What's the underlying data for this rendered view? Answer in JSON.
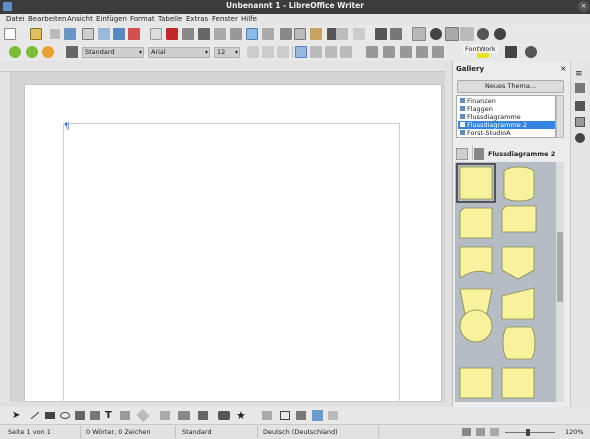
{
  "window": {
    "title": "Unbenannt 1 - LibreOffice Writer",
    "close_glyph": "×"
  },
  "menubar": [
    "Datei",
    "Bearbeiten",
    "Ansicht",
    "Einfügen",
    "Format",
    "Tabelle",
    "Extras",
    "Fenster",
    "Hilfe"
  ],
  "formatting": {
    "style": "Standard",
    "font": "Arial",
    "size": "12"
  },
  "tooltip": "FontWork",
  "document": {
    "pilcrow": "¶"
  },
  "sidebar": {
    "panel_title": "Gallery",
    "close_glyph": "×",
    "new_theme_button": "Neues Thema...",
    "themes": [
      {
        "label": "Finanzen",
        "selected": false
      },
      {
        "label": "Flaggen",
        "selected": false
      },
      {
        "label": "Flussdiagramme",
        "selected": false
      },
      {
        "label": "Flussdiagramme 2",
        "selected": true
      },
      {
        "label": "Forst-StudioA",
        "selected": false
      }
    ],
    "current_theme": "Flussdiagramme 2",
    "shape_fill": "#f7f29b",
    "shape_stroke": "#8a8a50"
  },
  "statusbar": {
    "page": "Seite 1 von 1",
    "words": "0 Wörter, 0 Zeichen",
    "page_style": "Standard",
    "language": "Deutsch (Deutschland)",
    "zoom": "120%"
  },
  "colors": {
    "accent": "#3584e4",
    "titlebar": "#3c3c3c"
  }
}
